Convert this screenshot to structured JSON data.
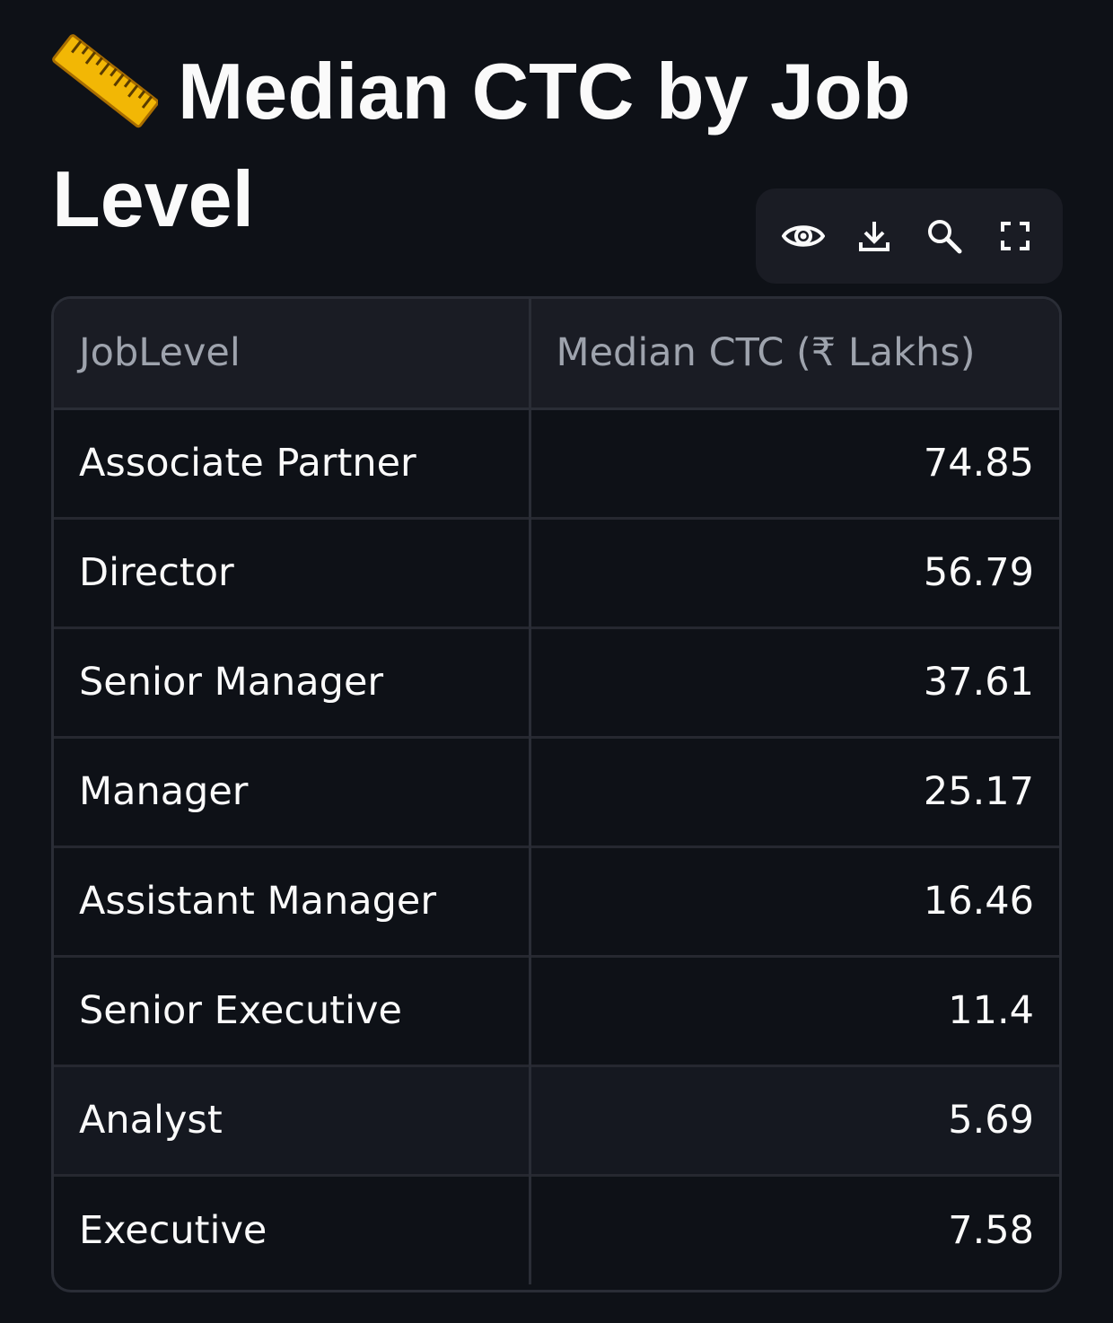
{
  "page": {
    "title": "Median CTC by Job Level",
    "title_icon": "ruler-emoji"
  },
  "toolbar": {
    "icons": [
      "eye-icon",
      "download-icon",
      "search-icon",
      "fullscreen-icon"
    ]
  },
  "table": {
    "columns": [
      "JobLevel",
      "Median CTC (₹ Lakhs)"
    ],
    "rows": [
      {
        "job_level": "Associate Partner",
        "median_ctc": "74.85"
      },
      {
        "job_level": "Director",
        "median_ctc": "56.79"
      },
      {
        "job_level": "Senior Manager",
        "median_ctc": "37.61"
      },
      {
        "job_level": "Manager",
        "median_ctc": "25.17"
      },
      {
        "job_level": "Assistant Manager",
        "median_ctc": "16.46"
      },
      {
        "job_level": "Senior Executive",
        "median_ctc": "11.4"
      },
      {
        "job_level": "Analyst",
        "median_ctc": "5.69"
      },
      {
        "job_level": "Executive",
        "median_ctc": "7.58"
      }
    ]
  },
  "colors": {
    "background": "#0e1117",
    "header_bg": "#1a1c24",
    "border": "#2a2d36",
    "text": "#fafafa",
    "header_text": "#9ea3ad",
    "ruler": "#f4c430"
  }
}
